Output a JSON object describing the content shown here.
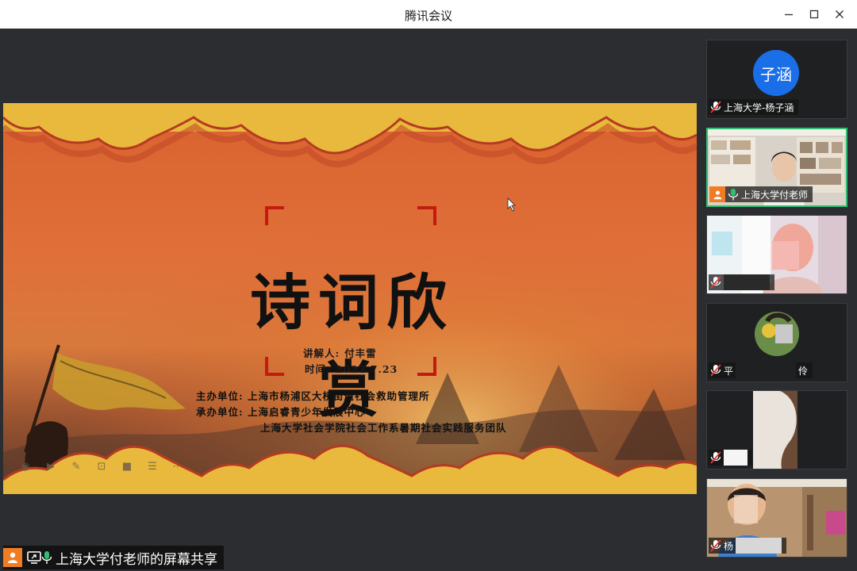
{
  "window": {
    "title": "腾讯会议"
  },
  "slide": {
    "title": "诗词欣赏",
    "speaker_label": "讲解人:",
    "speaker": "付丰雷",
    "date_label": "时间:",
    "date": "2022.7.23",
    "host_label": "主办单位:",
    "host": "上海市杨浦区大桥街道社会救助管理所",
    "organizer_label": "承办单位:",
    "organizer": "上海启睿青少年发展中心",
    "organizer2": "上海大学社会学院社会工作系暑期社会实践服务团队"
  },
  "share": {
    "label": "上海大学付老师的屏幕共享"
  },
  "participants": [
    {
      "avatar_text": "子涵",
      "name": "上海大学-杨子涵",
      "muted": true
    },
    {
      "name": "上海大学付老师",
      "muted": false,
      "speaking": true
    },
    {
      "name": "",
      "muted": true
    },
    {
      "name_prefix": "平",
      "name_suffix": "伶",
      "muted": true
    },
    {
      "name": "",
      "muted": true
    },
    {
      "name": "杨",
      "muted": true
    }
  ],
  "colors": {
    "accent": "#2fbf71",
    "avatar_blue": "#1a6fe8",
    "host_orange": "#f07c23",
    "slide_orange": "#d9622f",
    "slide_gold": "#e8b93c"
  }
}
